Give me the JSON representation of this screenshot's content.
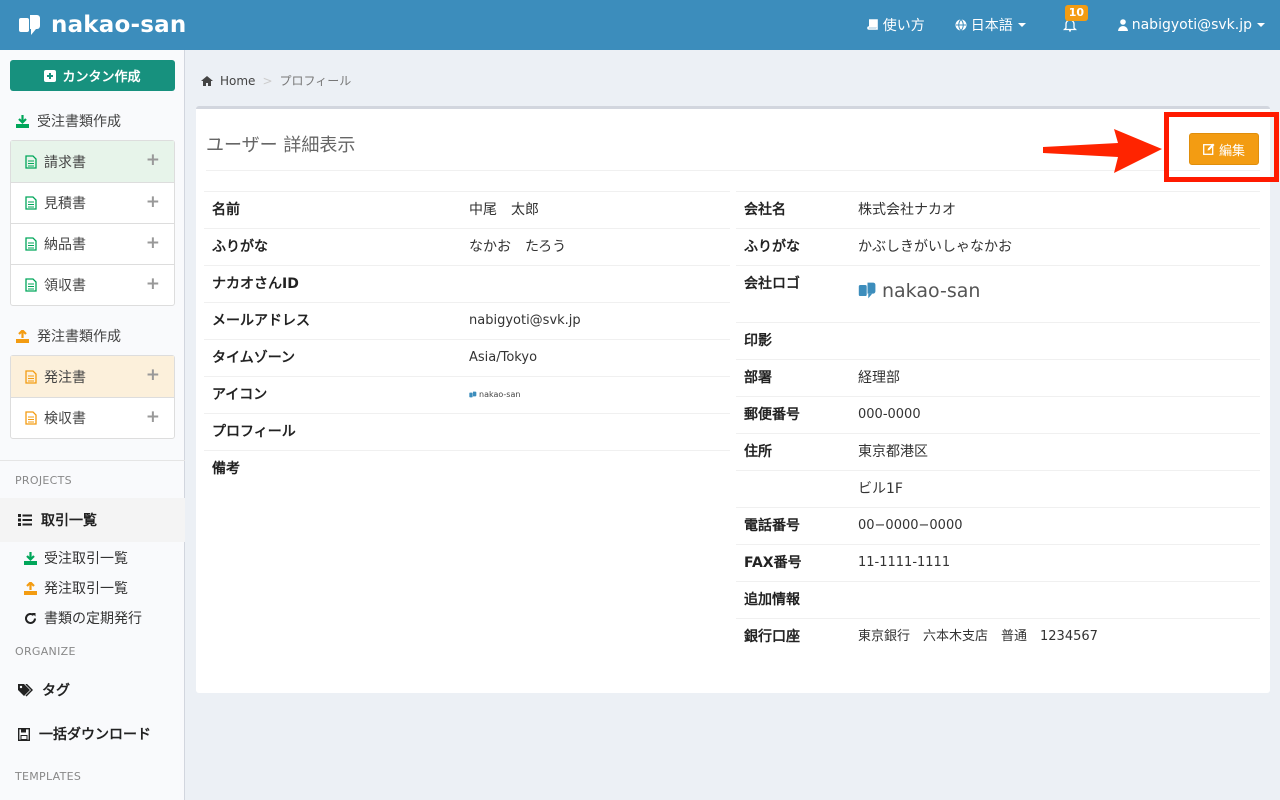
{
  "header": {
    "brand": "nakao-san",
    "nav": {
      "help": "使い方",
      "language": "日本語",
      "notifications_count": "10",
      "user": "nabigyoti@svk.jp"
    }
  },
  "sidebar": {
    "quick_create": "カンタン作成",
    "receive_section": "受注書類作成",
    "receive_items": [
      "請求書",
      "見積書",
      "納品書",
      "領収書"
    ],
    "order_section": "発注書類作成",
    "order_items": [
      "発注書",
      "検収書"
    ],
    "projects_label": "PROJECTS",
    "deals_label": "取引一覧",
    "deals_sub": [
      "受注取引一覧",
      "発注取引一覧",
      "書類の定期発行"
    ],
    "organize_label": "ORGANIZE",
    "tags_label": "タグ",
    "bulk_download_label": "一括ダウンロード",
    "templates_label": "TEMPLATES"
  },
  "breadcrumb": {
    "home": "Home",
    "current": "プロフィール"
  },
  "page": {
    "title": "ユーザー 詳細表示",
    "edit_label": "編集"
  },
  "user_fields": {
    "name_label": "名前",
    "name": "中尾　太郎",
    "kana_label": "ふりがな",
    "kana": "なかお　たろう",
    "id_label": "ナカオさんID",
    "id": "",
    "email_label": "メールアドレス",
    "email": "nabigyoti@svk.jp",
    "tz_label": "タイムゾーン",
    "tz": "Asia/Tokyo",
    "icon_label": "アイコン",
    "icon_text": "nakao-san",
    "profile_label": "プロフィール",
    "profile": "",
    "note_label": "備考",
    "note": ""
  },
  "company_fields": {
    "company_label": "会社名",
    "company": "株式会社ナカオ",
    "kana_label": "ふりがな",
    "kana": "かぶしきがいしゃなかお",
    "logo_label": "会社ロゴ",
    "logo_text": "nakao-san",
    "seal_label": "印影",
    "dept_label": "部署",
    "dept": "経理部",
    "zip_label": "郵便番号",
    "zip": "000-0000",
    "address_label": "住所",
    "address1": "東京都港区",
    "address2": "ビル1F",
    "tel_label": "電話番号",
    "tel": "00−0000−0000",
    "fax_label": "FAX番号",
    "fax": "11-1111-1111",
    "extra_label": "追加情報",
    "bank_label": "銀行口座",
    "bank": "東京銀行　六本木支店　普通　1234567"
  },
  "colors": {
    "header": "#3c8dbc",
    "quick_button": "#17917e",
    "edit_button": "#f39c12",
    "annotation": "#ff1a00"
  }
}
